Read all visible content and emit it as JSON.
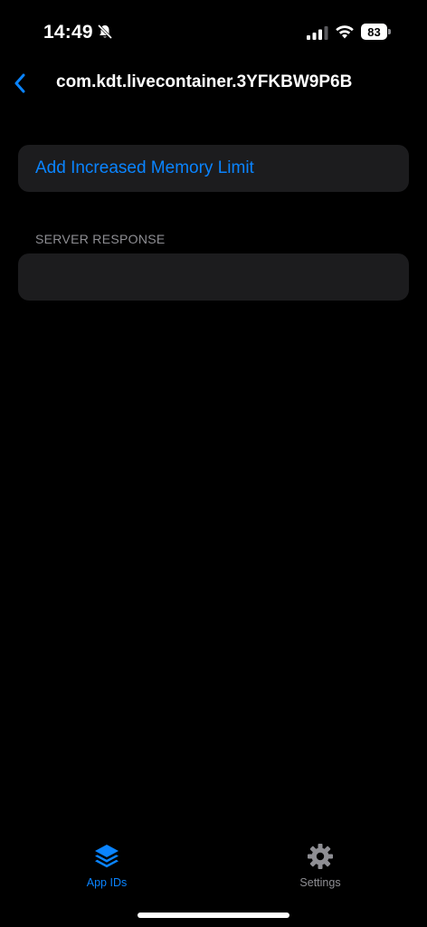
{
  "status_bar": {
    "time": "14:49",
    "battery_level": "83",
    "icons": [
      "bell-slash-icon",
      "cellular-signal-icon",
      "wifi-icon",
      "battery-icon"
    ]
  },
  "nav": {
    "back_icon": "chevron-left-icon",
    "title": "com.kdt.livecontainer.3YFKBW9P6B"
  },
  "main": {
    "action_label": "Add Increased Memory Limit",
    "server_response_header": "SERVER RESPONSE",
    "server_response_value": ""
  },
  "tab_bar": {
    "tabs": [
      {
        "label": "App IDs",
        "icon": "stack-icon",
        "active": true
      },
      {
        "label": "Settings",
        "icon": "gear-icon",
        "active": false
      }
    ]
  },
  "colors": {
    "accent": "#0a84ff",
    "background": "#000000",
    "cell_background": "#1c1c1e",
    "secondary_text": "#8e8e93"
  }
}
